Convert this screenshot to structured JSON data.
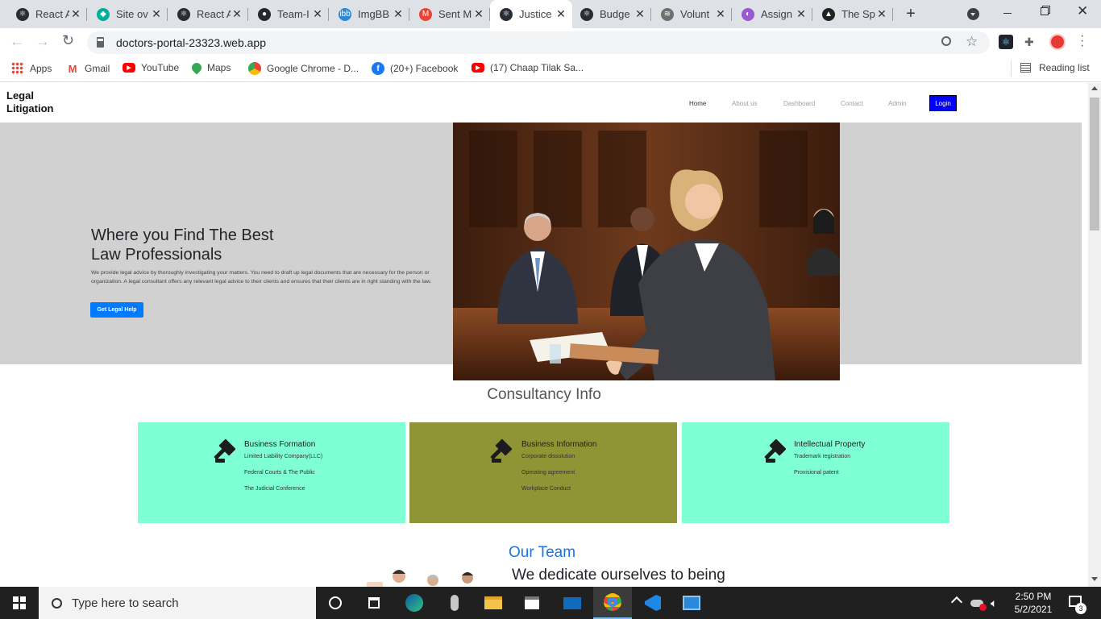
{
  "browser": {
    "tabs": [
      {
        "title": "React A",
        "color": "#282c34",
        "glyph": "⚛",
        "active": false
      },
      {
        "title": "Site ov",
        "color": "#00ad9f",
        "glyph": "◆",
        "active": false
      },
      {
        "title": "React A",
        "color": "#282c34",
        "glyph": "⚛",
        "active": false
      },
      {
        "title": "Team-I",
        "color": "#24292e",
        "glyph": "●",
        "active": false
      },
      {
        "title": "ImgBB",
        "color": "#2a8ad6",
        "glyph": "ibb",
        "active": false
      },
      {
        "title": "Sent M",
        "color": "#ea4335",
        "glyph": "M",
        "active": false
      },
      {
        "title": "Justice",
        "color": "#282c34",
        "glyph": "⚛",
        "active": true
      },
      {
        "title": "Budge",
        "color": "#282c34",
        "glyph": "⚛",
        "active": false
      },
      {
        "title": "Volunt",
        "color": "#6f6f6f",
        "glyph": "≋",
        "active": false
      },
      {
        "title": "Assign",
        "color": "#9b59d0",
        "glyph": "◐",
        "active": false
      },
      {
        "title": "The Sp",
        "color": "#222222",
        "glyph": "▲",
        "active": false
      }
    ],
    "new_tab": "+",
    "url": "doctors-portal-23323.web.app",
    "bookmarks": [
      {
        "label": "Apps",
        "icon": "apps-icon"
      },
      {
        "label": "Gmail",
        "icon": "gmail-icon"
      },
      {
        "label": "YouTube",
        "icon": "youtube-icon"
      },
      {
        "label": "Maps",
        "icon": "maps-icon"
      },
      {
        "label": "Google Chrome - D...",
        "icon": "chrome-icon"
      },
      {
        "label": "(20+) Facebook",
        "icon": "facebook-icon"
      },
      {
        "label": "(17) Chaap Tilak Sa...",
        "icon": "youtube-icon"
      }
    ],
    "reading_list": "Reading list"
  },
  "site": {
    "brand": "Legal\nLitigation",
    "nav": [
      "Home",
      "About us",
      "Dashboard",
      "Contact",
      "Admin"
    ],
    "login": "Login",
    "hero": {
      "title_line1": "Where you Find The Best",
      "title_line2": "Law Professionals",
      "description": "We provide legal advice by thoroughly investigating your matters. You need to draft up legal documents that are necessary for the person or organization. A legal consultant offers any relevant legal advice to their clients and ensures that their clients are in right standing with the law.",
      "cta": "Get Legal Help"
    },
    "consultancy_title": "Consultancy Info",
    "cards": [
      {
        "title": "Business Formation",
        "bg": "#7fffd4",
        "items": [
          "Limited Liability Company(LLC)",
          "Federal Courts & The Public",
          "The Judicial Conference"
        ]
      },
      {
        "title": "Business Information",
        "bg": "#8f9434",
        "items": [
          "Corporate dissolution",
          "Operating agreement",
          "Workplace Conduct"
        ]
      },
      {
        "title": "Intellectual Property",
        "bg": "#7fffd4",
        "items": [
          "Trademark registration",
          "Provisional patent"
        ]
      }
    ],
    "team_title": "Our Team",
    "team_subtitle": "We dedicate ourselves to being"
  },
  "taskbar": {
    "search_placeholder": "Type here to search",
    "time": "2:50 PM",
    "date": "5/2/2021",
    "notifications": "3"
  },
  "colors": {
    "accent": "#007bff",
    "login": "#0000ff",
    "heading": "#555555",
    "team": "#1a73e8"
  }
}
